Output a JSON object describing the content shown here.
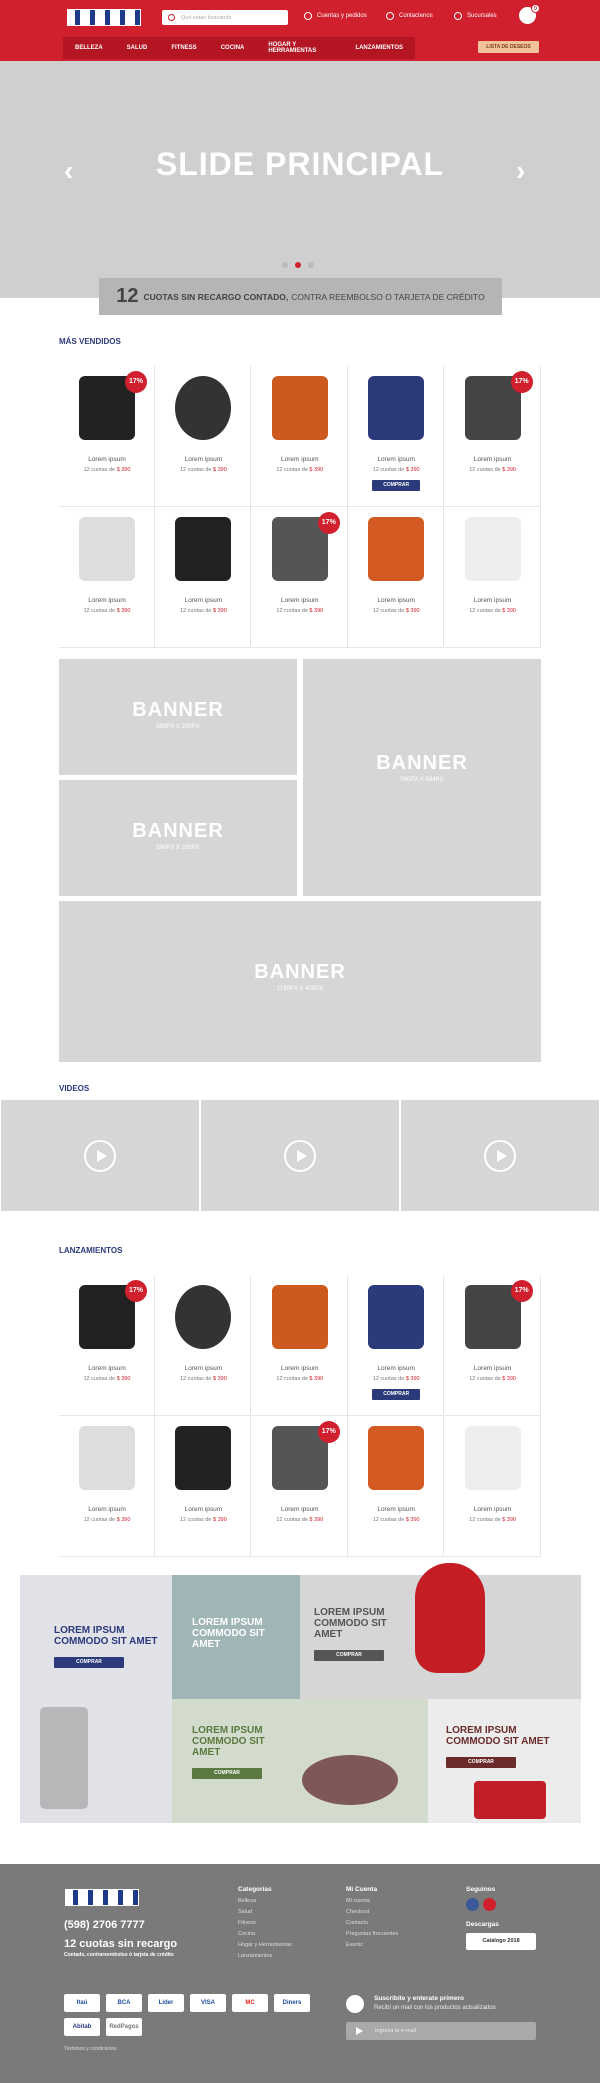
{
  "header": {
    "search_placeholder": "Qué estás buscando",
    "links": [
      "Cuentas y pedidos",
      "Contactenos",
      "Sucursales"
    ],
    "cart_count": "0",
    "nav": [
      "BELLEZA",
      "SALUD",
      "FITNESS",
      "COCINA",
      "HOGAR Y HERRAMIENTAS",
      "LANZAMIENTOS"
    ],
    "wishlist": "LISTA DE DESEOS"
  },
  "slider": {
    "title": "SLIDE PRINCIPAL",
    "prev": "‹",
    "next": "›"
  },
  "cuotas": {
    "num": "12",
    "bold": "CUOTAS SIN RECARGO CONTADO,",
    "rest": "CONTRA REEMBOLSO O TARJETA DE CRÉDITO"
  },
  "sections": {
    "best": "MÁS VENDIDOS",
    "videos": "VIDEOS",
    "launches": "LANZAMIENTOS"
  },
  "product": {
    "name": "Lorem ipsum",
    "cuotas": "12 cuotas de",
    "price": "$ 390",
    "badge": "17%",
    "buy": "COMPRAR"
  },
  "banners": [
    {
      "title": "BANNER",
      "size": "590PX X 295PX"
    },
    {
      "title": "BANNER",
      "size": "590PX X 295PX"
    },
    {
      "title": "BANNER",
      "size": "590PX X 594PX"
    },
    {
      "title": "BANNER",
      "size": "1190PX X 400PX"
    }
  ],
  "promos": {
    "p1": "LOREM IPSUM COMMODO SIT AMET",
    "p2": "LOREM IPSUM COMMODO SIT AMET",
    "p3": "LOREM IPSUM COMMODO SIT AMET",
    "p4": "LOREM IPSUM COMMODO SIT AMET",
    "p5": "LOREM IPSUM COMMODO SIT AMET",
    "btn": "COMPRAR"
  },
  "footer": {
    "phone": "(598) 2706 7777",
    "cuotas_title": "12 cuotas sin recargo",
    "cuotas_sub": "Contado, contrareembolso ó tarjeta de crédito",
    "cat_title": "Categorías",
    "cats": [
      "Belleza",
      "Salud",
      "Fitness",
      "Cocina",
      "Hogar y Herramientas",
      "Lanzamientos"
    ],
    "acc_title": "Mi Cuenta",
    "accs": [
      "Mi cuenta",
      "Checkout",
      "Contacto",
      "Preguntas frecuentes",
      "Eventz"
    ],
    "follow": "Seguinos",
    "downloads": "Descargas",
    "catalog": "Catálogo 2018",
    "newsletter_title": "Suscribite y enterate primero",
    "newsletter_sub": "Recibí un mail con los productos actualizados",
    "email_placeholder": "Ingresa tu e-mail",
    "terms": "Términos y condiciones",
    "payments": [
      "Itaú",
      "BCA",
      "Líder",
      "VISA",
      "MC",
      "Diners",
      "Abitab",
      "RedPagos"
    ]
  },
  "colors": {
    "brand_red": "#d01f2d",
    "navy": "#2b3a7b",
    "footer_gray": "#7a7a7a"
  }
}
